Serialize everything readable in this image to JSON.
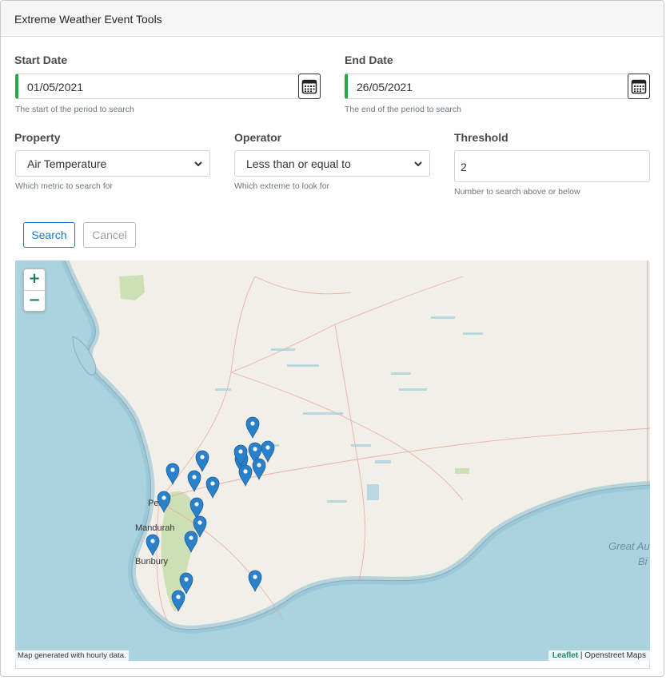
{
  "header": {
    "title": "Extreme Weather Event Tools"
  },
  "start_date": {
    "label": "Start Date",
    "value": "01/05/2021",
    "help": "The start of the period to search"
  },
  "end_date": {
    "label": "End Date",
    "value": "26/05/2021",
    "help": "The end of the period to search"
  },
  "property": {
    "label": "Property",
    "value": "Air Temperature",
    "help": "Which metric to search for"
  },
  "operator": {
    "label": "Operator",
    "value": "Less than or equal to",
    "help": "Which extreme to look for"
  },
  "threshold": {
    "label": "Threshold",
    "value": "2",
    "help": "Number to search above or below"
  },
  "buttons": {
    "search": "Search",
    "cancel": "Cancel"
  },
  "map": {
    "zoom_in": "+",
    "zoom_out": "−",
    "places": {
      "perth": "Perth",
      "mandurah": "Mandurah",
      "bunbury": "Bunbury",
      "great_aus_bight": "Great Au",
      "bight": "Bi"
    },
    "attribution_left": "Map generated with hourly data.",
    "attribution_leaflet": "Leaflet",
    "attribution_sep": " | ",
    "attribution_osm": "Openstreet Maps",
    "marker_count": 19
  },
  "colors": {
    "accent": "#1976d2",
    "valid_border": "#28a745",
    "marker": "#2a81cb",
    "sea": "#aad3df",
    "land": "#f2efe9",
    "park": "#cddfb4"
  }
}
